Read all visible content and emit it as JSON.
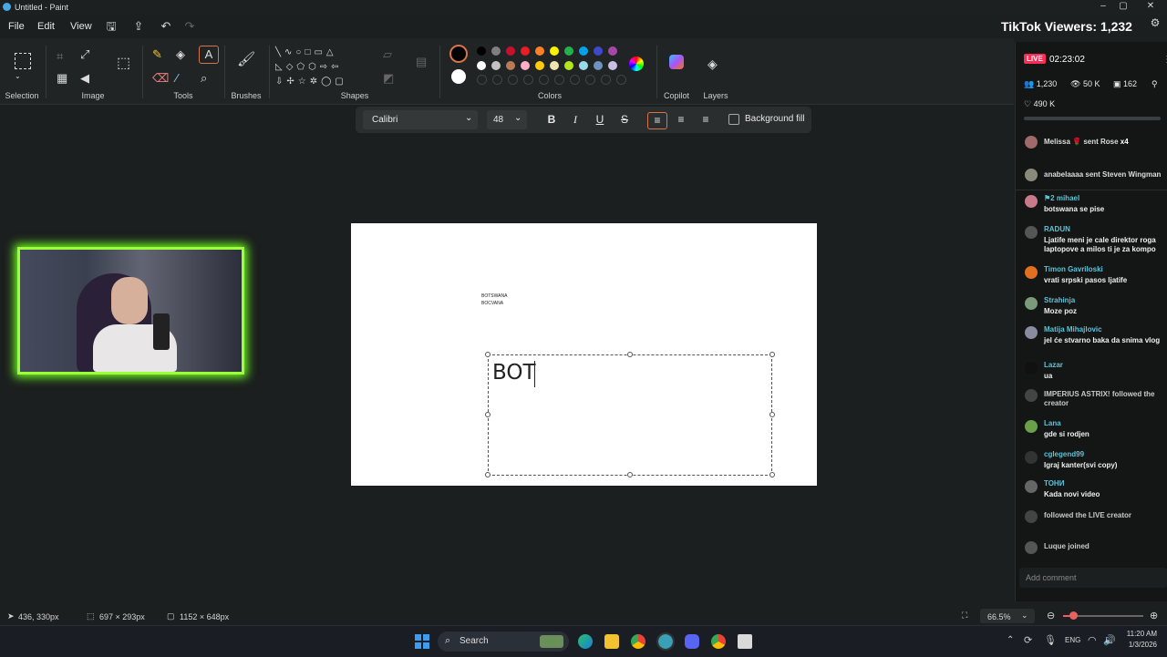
{
  "window": {
    "title": "Untitled - Paint",
    "controls": [
      "–",
      "▢",
      "✕"
    ]
  },
  "menu": {
    "file": "File",
    "edit": "Edit",
    "view": "View"
  },
  "ribbon": {
    "groups": {
      "selection": "Selection",
      "image": "Image",
      "tools": "Tools",
      "brushes": "Brushes",
      "shapes": "Shapes",
      "colors": "Colors",
      "copilot": "Copilot",
      "layers": "Layers"
    },
    "palette_row1": [
      "#000000",
      "#7f7f7f",
      "#c8102e",
      "#ec1c24",
      "#ff7f27",
      "#fff200",
      "#22b14c",
      "#00a2e8",
      "#3f48cc",
      "#a349a4"
    ],
    "palette_row2": [
      "#ffffff",
      "#c3c3c3",
      "#b97a57",
      "#ffaec9",
      "#ffc90e",
      "#efe4b0",
      "#b5e61d",
      "#99d9ea",
      "#7092be",
      "#c8bfe7"
    ]
  },
  "text_toolbar": {
    "font": "Calibri",
    "size": "48",
    "background_fill": "Background fill"
  },
  "canvas": {
    "note_line1": "BOTSWANA",
    "note_line2": "BOCVANA",
    "typed_text": "BOT"
  },
  "statusbar": {
    "cursor_pos": "436, 330px",
    "selection_size": "697 × 293px",
    "canvas_size": "1152 × 648px",
    "zoom": "66.5%"
  },
  "taskbar": {
    "search": "Search",
    "lang": "ENG",
    "time": "11:20 AM",
    "date": "1/3/2026"
  },
  "tiktok": {
    "viewers_label": "TikTok Viewers: 1,232",
    "live_badge": "LIVE",
    "duration": "02:23:02",
    "viewers": "1,230",
    "views": "50 K",
    "stat3": "162",
    "likes": "490 K",
    "gifts": [
      {
        "user": "Melissa",
        "text": "sent Rose",
        "count": "x4"
      },
      {
        "user": "anabelaaaa",
        "text": "sent Steven Wingman"
      }
    ],
    "chat": [
      {
        "user": "mihael",
        "badge": "2",
        "msg": "botswana se pise",
        "avatar": "#c97a8a"
      },
      {
        "user": "RADUN",
        "msg": "Ljatife meni je cale direktor roga laptopove a milos ti je za kompo",
        "avatar": "#555"
      },
      {
        "user": "Timon Gavriloski",
        "msg": "vrati srpski pasos ljatife",
        "avatar": "#e07020"
      },
      {
        "user": "Strahinja",
        "msg": "Moze poz",
        "avatar": "#7a9a7a"
      },
      {
        "user": "Matija Mihajlovic",
        "msg": "jel će stvarno baka da snima vlog",
        "avatar": "#8a8aa0"
      },
      {
        "user": "Lazar",
        "msg": "ua",
        "avatar": "#111"
      },
      {
        "user": "IMPERIUS ASTRIX!",
        "msg": "followed the creator",
        "system": true,
        "avatar": "#444"
      },
      {
        "user": "Lana",
        "msg": "gde si rodjen",
        "avatar": "#6aa04a"
      },
      {
        "user": "cglegend99",
        "msg": "Igraj kanter(svi copy)",
        "avatar": "#333"
      },
      {
        "user": "ТОНИ",
        "msg": "Kada novi video",
        "avatar": "#666"
      },
      {
        "user": "",
        "msg": "followed the LIVE creator",
        "system": true,
        "avatar": "#444"
      },
      {
        "user": "Luque",
        "msg": "joined",
        "system": true,
        "avatar": "#555"
      }
    ],
    "add_comment": "Add comment"
  }
}
